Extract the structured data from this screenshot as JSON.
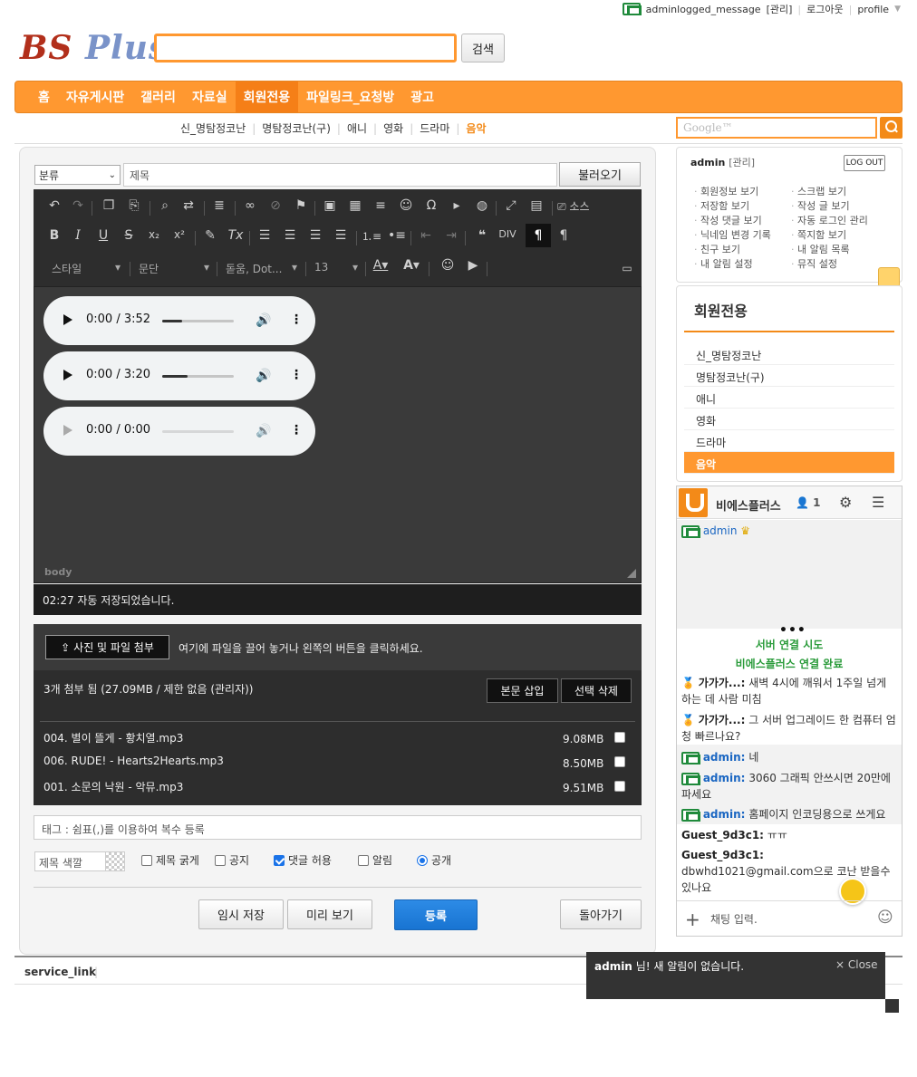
{
  "topbar": {
    "user": "adminlogged_message",
    "admin_link": "[관리]",
    "logout": "로그아웃",
    "profile": "profile"
  },
  "logo": {
    "part1": "BS",
    "part2": "Plus"
  },
  "search": {
    "button": "검색"
  },
  "nav": {
    "items": [
      "홈",
      "자유게시판",
      "갤러리",
      "자료실",
      "회원전용",
      "파일링크_요청방",
      "광고"
    ],
    "active": "회원전용"
  },
  "subnav": {
    "items": [
      "신_명탐정코난",
      "명탐정코난(구)",
      "애니",
      "영화",
      "드라마",
      "음악"
    ],
    "active": "음악"
  },
  "google": {
    "placeholder": "Google™"
  },
  "form": {
    "category": "분류",
    "title_placeholder": "제목",
    "load_button": "불러오기",
    "editor": {
      "toolbar_dropdowns": [
        "스타일",
        "문단",
        "돋움, Dot...",
        "13"
      ],
      "source_label": "소스",
      "audio": [
        {
          "time": "0:00 / 3:52",
          "buffered": 0.28
        },
        {
          "time": "0:00 / 3:20",
          "buffered": 0.36
        },
        {
          "time": "0:00 / 0:00",
          "buffered": 0
        }
      ],
      "path": "body"
    },
    "autosave": "02:27 자동 저장되었습니다.",
    "attach": {
      "button": "사진 및 파일 첨부",
      "hint": "여기에 파일을 끌어 놓거나 왼쪽의 버튼을 클릭하세요.",
      "count": "3개 첨부 됨 (27.09MB / 제한 없음 (관리자))",
      "insert": "본문 삽입",
      "delete": "선택 삭제",
      "files": [
        {
          "name": "004. 별이 뜰게 - 황치열.mp3",
          "size": "9.08MB"
        },
        {
          "name": "006. RUDE! - Hearts2Hearts.mp3",
          "size": "8.50MB"
        },
        {
          "name": "001. 소문의 낙원 - 악뮤.mp3",
          "size": "9.51MB"
        }
      ]
    },
    "tag_placeholder": "태그 : 쉼표(,)를 이용하여 복수 등록",
    "title_color": "제목 색깔",
    "options": {
      "bold": "제목 굵게",
      "notice": "공지",
      "comment": "댓글 허용",
      "alarm": "알림",
      "public": "공개"
    },
    "buttons": {
      "temp": "임시 저장",
      "preview": "미리 보기",
      "submit": "등록",
      "back": "돌아가기"
    }
  },
  "footer": {
    "link": "service_link"
  },
  "login": {
    "user": "admin",
    "admin": "[관리]",
    "logout": "LOG OUT",
    "links": [
      "회원정보 보기",
      "스크랩 보기",
      "저장함 보기",
      "작성 글 보기",
      "작성 댓글 보기",
      "자동 로그인 관리",
      "닉네임 변경 기록",
      "쪽지함 보기",
      "친구 보기",
      "내 알림 목록",
      "내 알림 설정",
      "뮤직 설정"
    ]
  },
  "member": {
    "title": "회원전용",
    "items": [
      "신_명탐정코난",
      "명탐정코난(구)",
      "애니",
      "영화",
      "드라마",
      "음악"
    ],
    "active": "음악"
  },
  "chat": {
    "name": "비에스플러스",
    "users": "1",
    "online_user": "admin",
    "dots": "•••",
    "sys1": "서버 연결 시도",
    "sys2": "비에스플러스 연결 완료",
    "messages": [
      {
        "user": "가가가...:",
        "text": "새벽 4시에 깨워서 1주일 넘게 하는 데 사람 미침"
      },
      {
        "user": "가가가...:",
        "text": "그 서버 업그레이드 한 컴퓨터 엄청 빠르나요?"
      },
      {
        "user": "admin:",
        "text": "네"
      },
      {
        "user": "admin:",
        "text": "3060 그래픽 안쓰시면 20만에 파세요"
      },
      {
        "user": "admin:",
        "text": "홈페이지 인코딩용으로 쓰게요"
      },
      {
        "user": "Guest_9d3c1:",
        "text": "ㅠㅠ"
      },
      {
        "user": "Guest_9d3c1:",
        "text": "dbwhd1021@gmail.com으로 코난 받을수있나요"
      }
    ],
    "input_placeholder": "채팅 입력."
  },
  "toast": {
    "user": "admin",
    "message": "님!  새 알림이 없습니다.",
    "close": "× Close"
  },
  "colors": {
    "accent": "#ff9830",
    "active": "#f57f17",
    "green": "#2a9b3a",
    "blue": "#1874d2"
  }
}
